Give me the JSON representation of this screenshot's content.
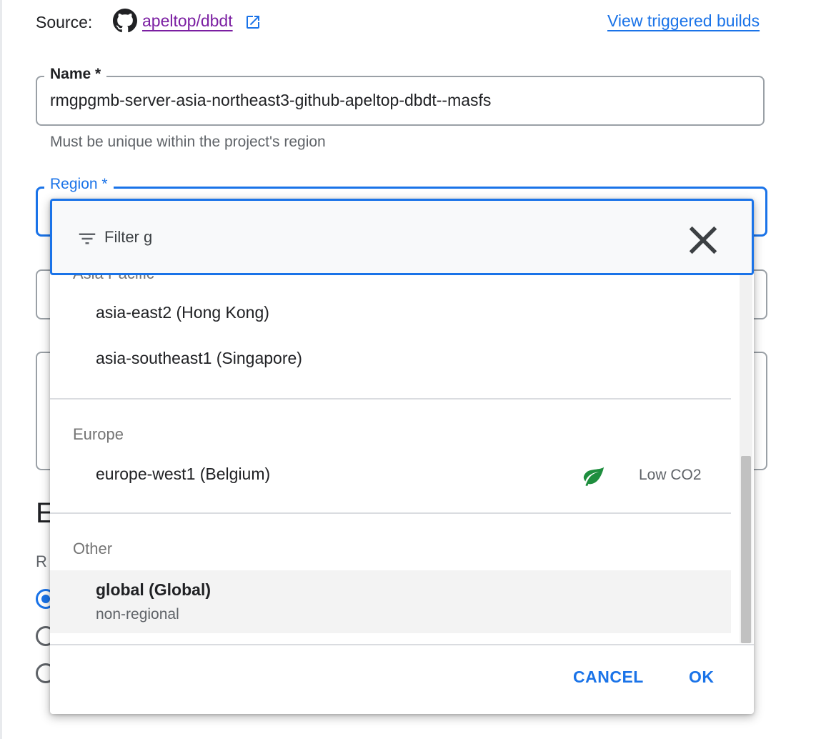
{
  "source": {
    "label": "Source:",
    "repo": "apeltop/dbdt",
    "view_builds": "View triggered builds"
  },
  "name_field": {
    "label": "Name *",
    "value": "rmgpgmb-server-asia-northeast3-github-apeltop-dbdt--masfs",
    "hint": "Must be unique within the project's region"
  },
  "region_field": {
    "label": "Region *"
  },
  "background": {
    "heading_fragment": "E",
    "sub_fragment": "R"
  },
  "dropdown": {
    "filter_label": "Filter",
    "filter_value": "g",
    "groups": [
      {
        "name": "Asia Pacific",
        "options": [
          {
            "label": "asia-east2 (Hong Kong)"
          },
          {
            "label": "asia-southeast1 (Singapore)"
          }
        ]
      },
      {
        "name": "Europe",
        "options": [
          {
            "label": "europe-west1 (Belgium)",
            "badge": "Low CO2"
          }
        ]
      },
      {
        "name": "Other",
        "options": [
          {
            "label": "global (Global)",
            "sub": "non-regional",
            "selected": true
          }
        ]
      }
    ],
    "scroll_position": 0.49,
    "cancel": "CANCEL",
    "ok": "OK"
  },
  "icons": {
    "source_repo": "github-icon",
    "repo_link": "external-link-icon",
    "filter": "filter-list-icon",
    "clear": "close-icon",
    "low_co2": "leaf-icon"
  },
  "colors": {
    "accent": "#1a73e8",
    "visited_link": "#7b1fa2",
    "leaf": "#1e8e3e"
  }
}
